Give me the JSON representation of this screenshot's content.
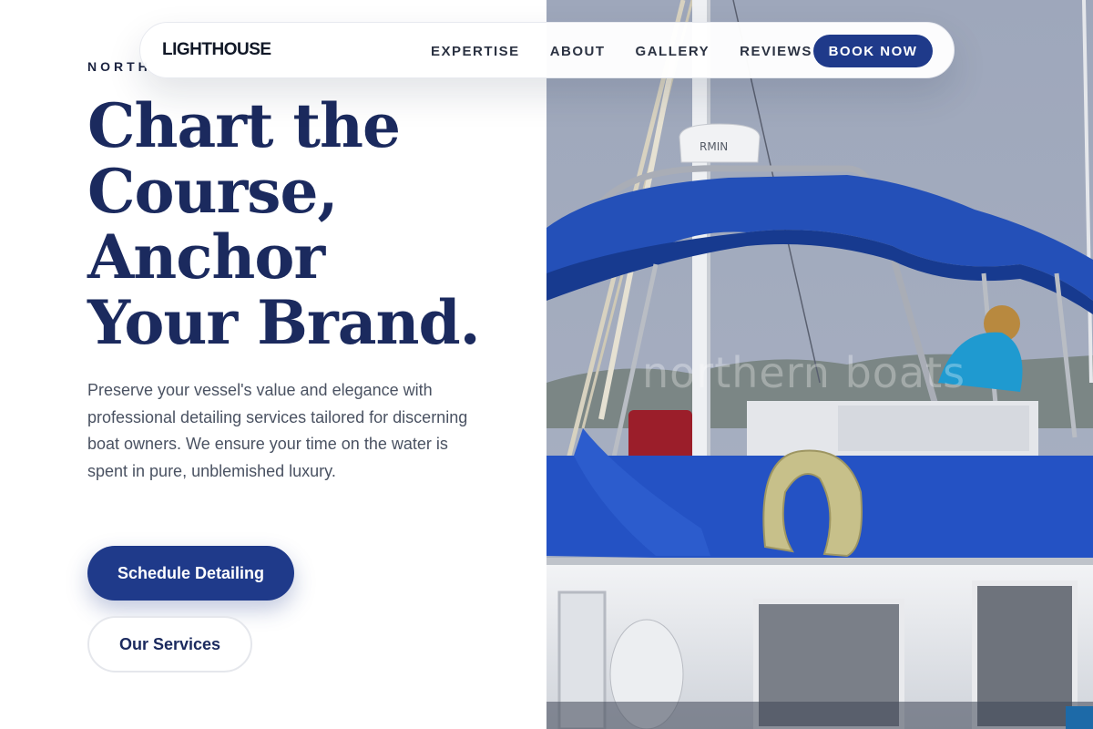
{
  "nav": {
    "logo": "LIGHTHOUSE",
    "links": [
      "EXPERTISE",
      "ABOUT",
      "GALLERY",
      "REVIEWS"
    ],
    "cta": "BOOK NOW"
  },
  "hero": {
    "eyebrow": "NORTH",
    "headline_lines": [
      "Chart the",
      "Course,",
      "Anchor",
      "Your Brand."
    ],
    "intro": "Preserve your vessel's value and elegance with professional detailing services tailored for discerning boat owners. We ensure your time on the water is spent in pure, unblemished luxury.",
    "primary_button": "Schedule Detailing",
    "secondary_button": "Our Services"
  },
  "image": {
    "watermark": "northern boats",
    "dome_text": "RMIN"
  },
  "colors": {
    "accent": "#1f3a8a",
    "headline": "#1b2a5e",
    "canopy": "#1f47b8",
    "sky": "#9aa3b6"
  }
}
